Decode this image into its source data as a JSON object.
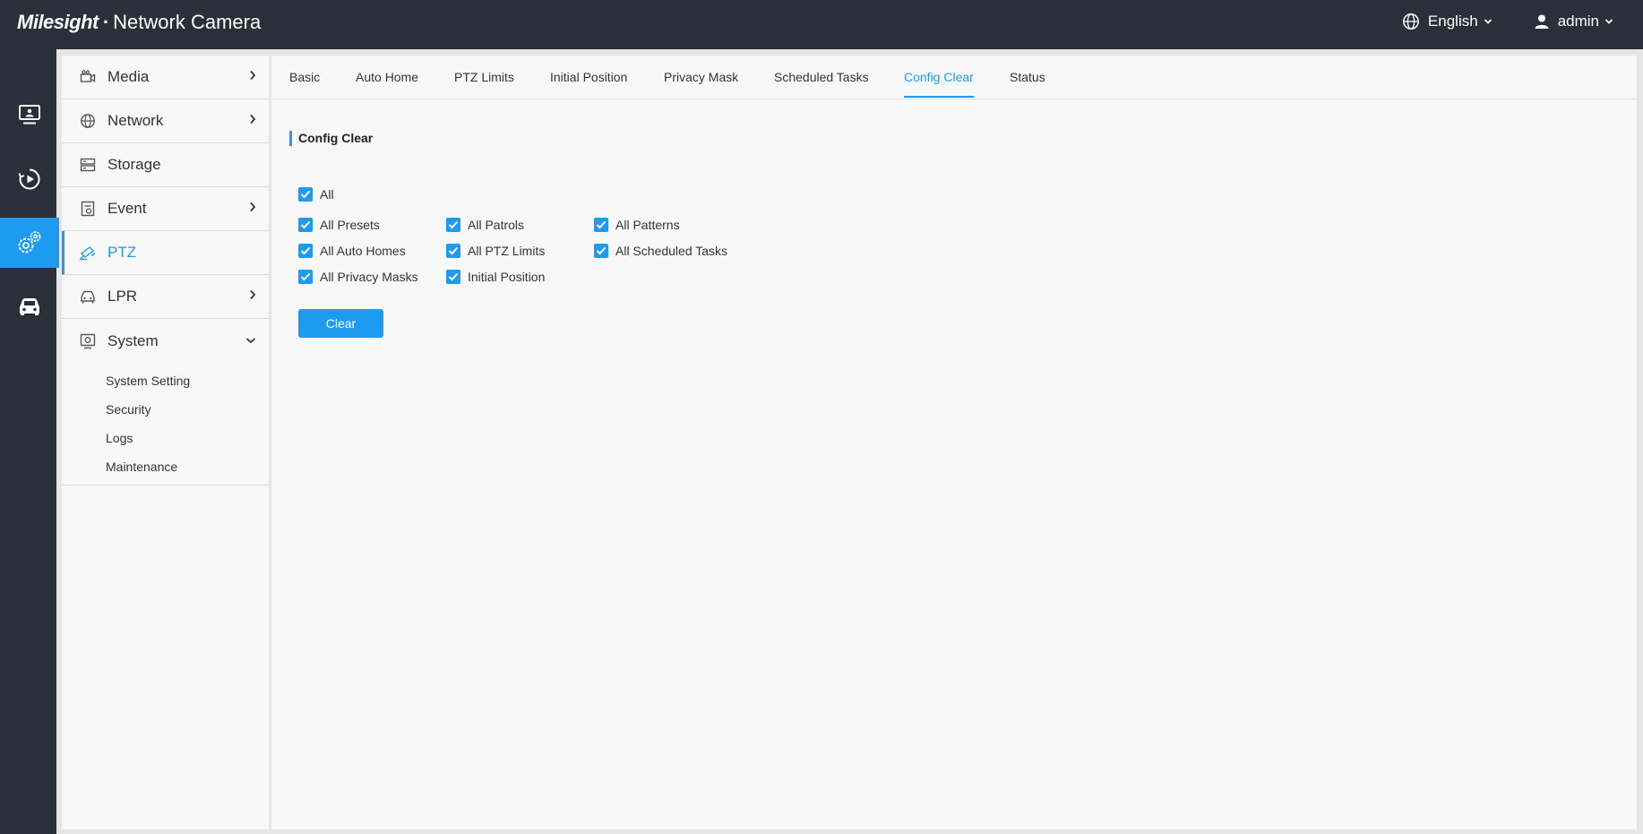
{
  "header": {
    "brand": "Milesight",
    "separator": "·",
    "product": "Network Camera",
    "language": "English",
    "user": "admin"
  },
  "rail": {
    "items": [
      {
        "icon": "live-view-icon"
      },
      {
        "icon": "playback-icon"
      },
      {
        "icon": "settings-icon",
        "active": true
      },
      {
        "icon": "vehicle-icon"
      }
    ]
  },
  "sidebar": {
    "items": [
      {
        "label": "Media",
        "icon": "camera-icon",
        "expandable": true
      },
      {
        "label": "Network",
        "icon": "globe-icon",
        "expandable": true
      },
      {
        "label": "Storage",
        "icon": "storage-icon",
        "expandable": false
      },
      {
        "label": "Event",
        "icon": "event-icon",
        "expandable": true
      },
      {
        "label": "PTZ",
        "icon": "ptz-icon",
        "expandable": false,
        "active": true
      },
      {
        "label": "LPR",
        "icon": "car-icon",
        "expandable": true
      },
      {
        "label": "System",
        "icon": "system-icon",
        "expanded": true
      }
    ],
    "system_sub": [
      "System Setting",
      "Security",
      "Logs",
      "Maintenance"
    ]
  },
  "tabs": [
    "Basic",
    "Auto Home",
    "PTZ Limits",
    "Initial Position",
    "Privacy Mask",
    "Scheduled Tasks",
    "Config Clear",
    "Status"
  ],
  "active_tab": "Config Clear",
  "section_title": "Config Clear",
  "checkboxes": {
    "all": {
      "label": "All",
      "checked": true
    },
    "presets": {
      "label": "All Presets",
      "checked": true
    },
    "patrols": {
      "label": "All Patrols",
      "checked": true
    },
    "patterns": {
      "label": "All Patterns",
      "checked": true
    },
    "auto_homes": {
      "label": "All Auto Homes",
      "checked": true
    },
    "ptz_limits": {
      "label": "All PTZ Limits",
      "checked": true
    },
    "scheduled_tasks": {
      "label": "All Scheduled Tasks",
      "checked": true
    },
    "privacy_masks": {
      "label": "All Privacy Masks",
      "checked": true
    },
    "initial_position": {
      "label": "Initial Position",
      "checked": true
    }
  },
  "clear_button": "Clear",
  "colors": {
    "accent": "#1d9bf0",
    "topbar": "#2a2f3a"
  }
}
